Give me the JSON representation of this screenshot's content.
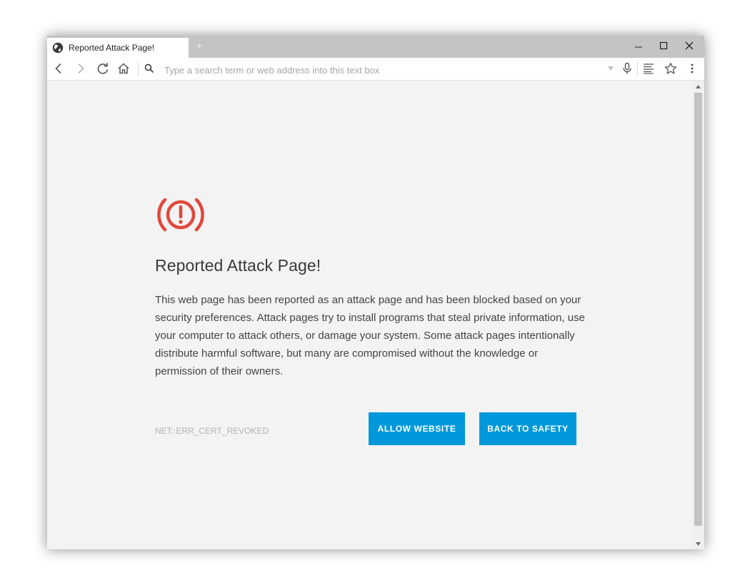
{
  "tab": {
    "title": "Reported Attack Page!",
    "new_tab": "+"
  },
  "toolbar": {
    "address_placeholder": "Type a search term or web address into this text box"
  },
  "page": {
    "heading": "Reported Attack Page!",
    "body": "This web page has been reported as an attack page and has been blocked based on your security preferences. Attack pages try to install programs that steal private information, use your computer to attack others, or damage your system. Some attack pages intentionally distribute harmful software, but many are compromised without the knowledge or permission of their owners.",
    "error_code": "NET::ERR_CERT_REVOKED",
    "allow_button": "ALLOW WEBSITE",
    "back_button": "BACK TO SAFETY"
  },
  "colors": {
    "accent": "#0098db",
    "alert": "#e0483b",
    "titlebar": "#c4c4c4",
    "content_bg": "#f3f3f3"
  },
  "icons": [
    "globe-icon",
    "minimize-icon",
    "maximize-icon",
    "close-icon",
    "back-icon",
    "forward-icon",
    "reload-icon",
    "home-icon",
    "search-icon",
    "dropdown-arrow-icon",
    "microphone-icon",
    "reader-view-icon",
    "star-icon",
    "menu-icon",
    "alert-icon",
    "scroll-up-icon",
    "scroll-down-icon"
  ]
}
